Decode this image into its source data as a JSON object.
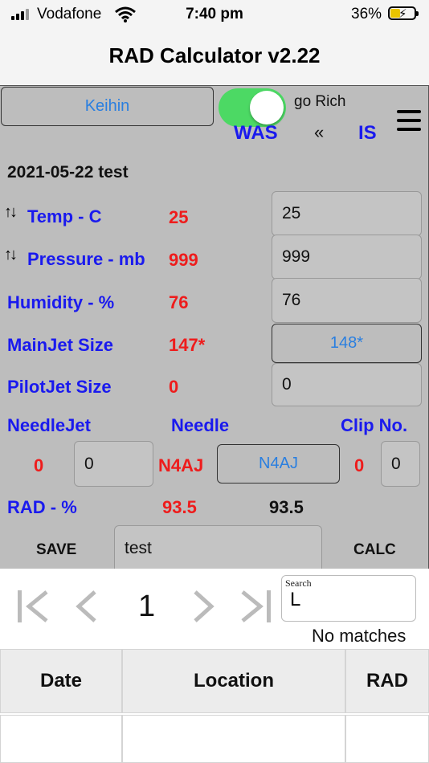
{
  "status_bar": {
    "carrier": "Vodafone",
    "time": "7:40 pm",
    "battery": "36%"
  },
  "nav": {
    "title": "RAD Calculator v2.22"
  },
  "toolbar": {
    "carb_button": "Keihin",
    "toggle_label": "go Rich",
    "toggle_on": true,
    "was_label": "WAS",
    "arrow_label": "«",
    "is_label": "IS",
    "menu_icon": "hamburger-icon"
  },
  "record_title": "2021-05-22 test",
  "rows": {
    "temp": {
      "label": "Temp - C",
      "was": "25",
      "is": "25",
      "icon": "sort-arrows-icon"
    },
    "pressure": {
      "label": "Pressure - mb",
      "was": "999",
      "is": "999",
      "icon": "sort-arrows-icon"
    },
    "humidity": {
      "label": "Humidity - %",
      "was": "76",
      "is": "76"
    },
    "mainjet": {
      "label": "MainJet Size",
      "was": "147*",
      "is": "148*"
    },
    "pilotjet": {
      "label": "PilotJet Size",
      "was": "0",
      "is": "0"
    }
  },
  "needle_headers": {
    "needlejet": "NeedleJet",
    "needle": "Needle",
    "clip": "Clip No."
  },
  "needle_row": {
    "needlejet_was": "0",
    "needlejet_is": "0",
    "needle_was": "N4AJ",
    "needle_is": "N4AJ",
    "clip_was": "0",
    "clip_is": "0"
  },
  "rad": {
    "label": "RAD - %",
    "was": "93.5",
    "is": "93.5"
  },
  "actions": {
    "save": "SAVE",
    "name_value": "test",
    "calc": "CALC"
  },
  "pager": {
    "first": "|<",
    "prev": "<",
    "page": "1",
    "next": ">",
    "last": ">|"
  },
  "search": {
    "label": "Search",
    "value": "L",
    "result": "No matches"
  },
  "table": {
    "columns": [
      "Date",
      "Location",
      "RAD"
    ]
  },
  "colors": {
    "label_blue": "#1a1aee",
    "value_red": "#ee1c1c",
    "link_blue": "#2a7fe0",
    "toggle_green": "#4cd964",
    "panel_gray": "#bdbdbd"
  }
}
